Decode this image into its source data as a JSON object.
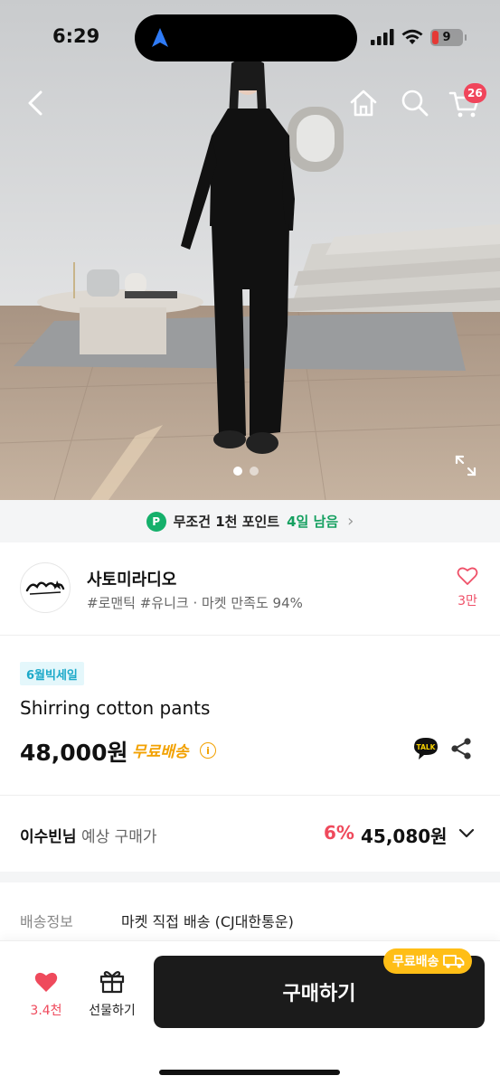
{
  "status_bar": {
    "time": "6:29",
    "battery": "9"
  },
  "nav": {
    "cart_count": "26"
  },
  "hero": {
    "image_count": 2,
    "active_index": 0
  },
  "points_banner": {
    "icon": "P",
    "text": "무조건 1천 포인트",
    "days": "4일 남음"
  },
  "shop": {
    "name": "사토미라디오",
    "tags": "#로맨틱 #유니크 · 마켓 만족도 94%",
    "favorite_count": "3만"
  },
  "product": {
    "badge": "6월빅세일",
    "title": "Shirring cotton pants",
    "price": "48,000원",
    "shipping_tag": "무료배송",
    "talk_label": "TALK"
  },
  "expected": {
    "user": "이수빈님",
    "label": "예상 구매가",
    "discount": "6%",
    "price": "45,080원"
  },
  "shipping_info": {
    "key": "배송정보",
    "value": "마켓 직접 배송 (CJ대한통운)"
  },
  "bottom_bar": {
    "like_count": "3.4천",
    "gift_label": "선물하기",
    "buy_label": "구매하기",
    "free_ship_tag": "무료배송"
  },
  "colors": {
    "accent_red": "#ef4a5c",
    "points_green": "#15b06b",
    "free_ship_orange": "#f2a100",
    "buy_button": "#1b1b1b"
  }
}
